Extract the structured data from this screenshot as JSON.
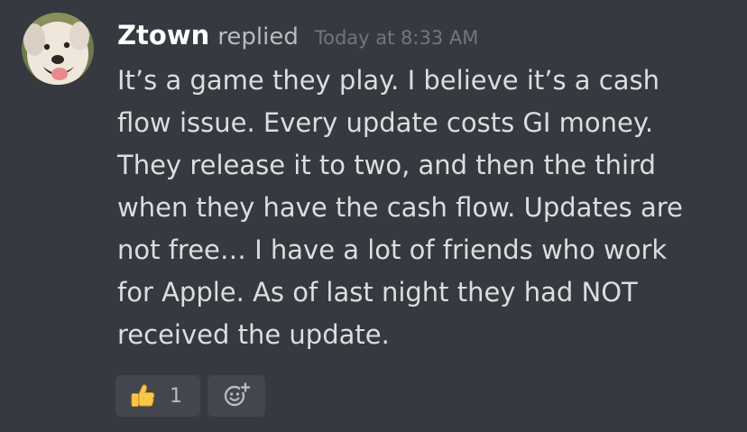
{
  "message": {
    "author": "Ztown",
    "action": "replied",
    "timestamp": "Today at 8:33 AM",
    "lines": [
      "It’s a game they play. I believe it’s a cash",
      "flow issue. Every update costs GI money.",
      "They release it to two, and then the third",
      "when they have the cash flow. Updates are",
      "not free… I have a lot of friends who work",
      "for Apple. As of last night they had NOT",
      "received the update."
    ]
  },
  "reactions": [
    {
      "icon": "thumbs-up-icon",
      "count": "1"
    }
  ],
  "add_reaction": {
    "icon": "add-reaction-smiley-icon"
  },
  "colors": {
    "background": "#36393f",
    "username": "#ffffff",
    "message_text": "#dcddde",
    "timestamp": "#72767d",
    "reaction_bg": "#43464c"
  }
}
